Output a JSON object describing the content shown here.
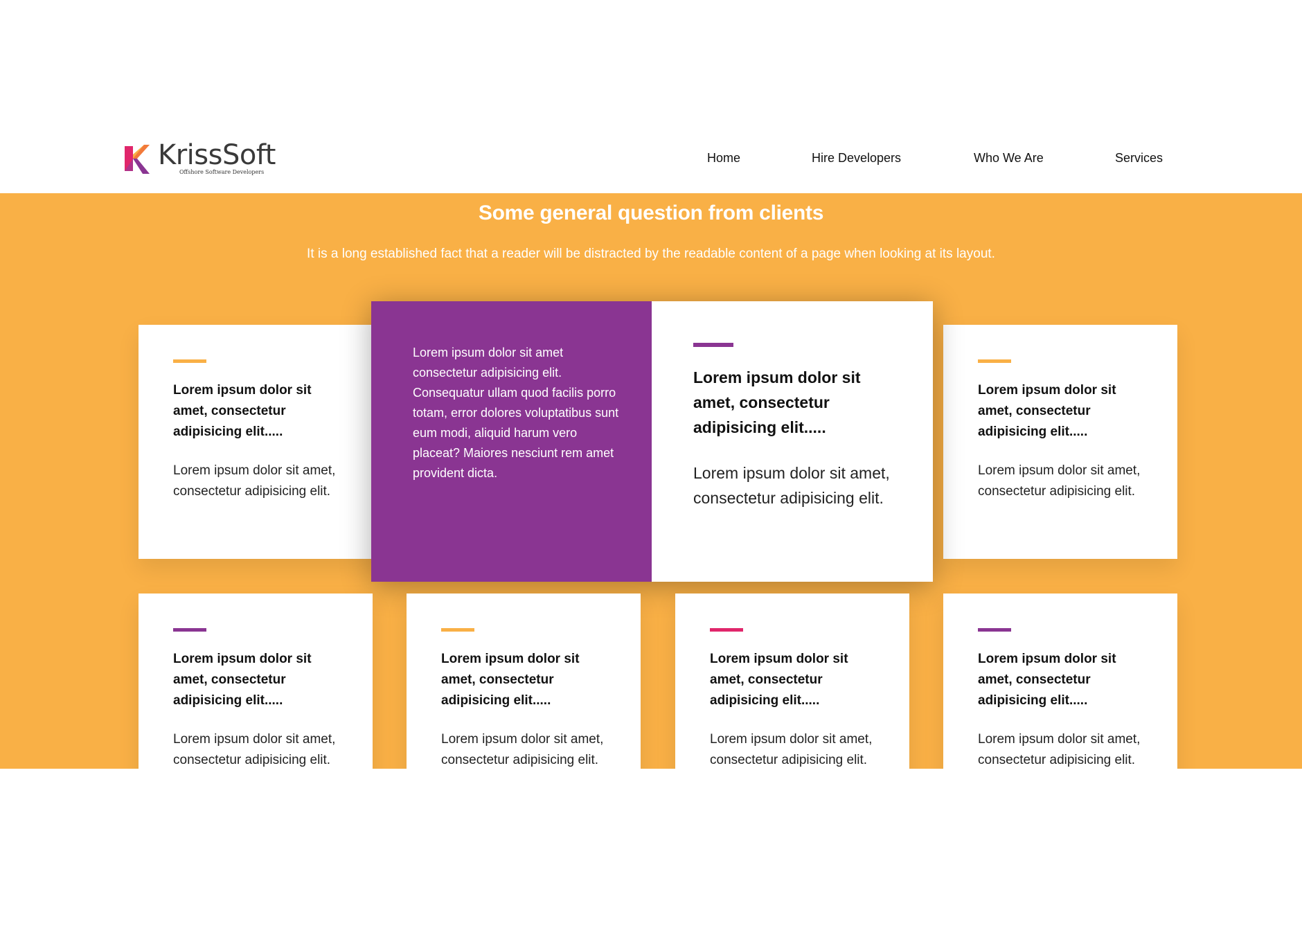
{
  "brand": {
    "name": "KrissSoft",
    "tagline": "Offshore Software Developers"
  },
  "nav": [
    {
      "label": "Home"
    },
    {
      "label": "Hire Developers"
    },
    {
      "label": "Who We Are"
    },
    {
      "label": "Services"
    }
  ],
  "section": {
    "title": "Some general question from clients",
    "subtitle": "It is a long established fact that a reader will be distracted by the readable content of a page when looking at its layout."
  },
  "colors": {
    "band": "#f9b046",
    "purple": "#8a3592",
    "orange": "#f9b046",
    "pink": "#e0266b"
  },
  "featured": {
    "description": "Lorem ipsum dolor sit amet consectetur adipisicing elit. Consequatur ullam quod facilis porro totam, error dolores voluptatibus sunt eum modi, aliquid harum vero placeat? Maiores nesciunt rem amet provident dicta.",
    "title": "Lorem ipsum dolor sit amet, consectetur adipisicing elit.....",
    "text": "Lorem ipsum dolor sit amet, consectetur adipisicing elit.",
    "accent": "#8a3592"
  },
  "cards": [
    {
      "title": "Lorem ipsum dolor sit amet, consectetur adipisicing elit.....",
      "text": "Lorem ipsum dolor sit amet, consectetur adipisicing elit.",
      "accent": "#f9b046"
    },
    {
      "title": "Lorem ipsum dolor sit amet, consectetur adipisicing elit.....",
      "text": "Lorem ipsum dolor sit amet, consectetur adipisicing elit.",
      "accent": "#f9b046"
    },
    {
      "title": "Lorem ipsum dolor sit amet, consectetur adipisicing elit.....",
      "text": "Lorem ipsum dolor sit amet, consectetur adipisicing elit.",
      "accent": "#8a3592"
    },
    {
      "title": "Lorem ipsum dolor sit amet, consectetur adipisicing elit.....",
      "text": "Lorem ipsum dolor sit amet, consectetur adipisicing elit.",
      "accent": "#f9b046"
    },
    {
      "title": "Lorem ipsum dolor sit amet, consectetur adipisicing elit.....",
      "text": "Lorem ipsum dolor sit amet, consectetur adipisicing elit.",
      "accent": "#e0266b"
    },
    {
      "title": "Lorem ipsum dolor sit amet, consectetur adipisicing elit.....",
      "text": "Lorem ipsum dolor sit amet, consectetur adipisicing elit.",
      "accent": "#8a3592"
    }
  ]
}
